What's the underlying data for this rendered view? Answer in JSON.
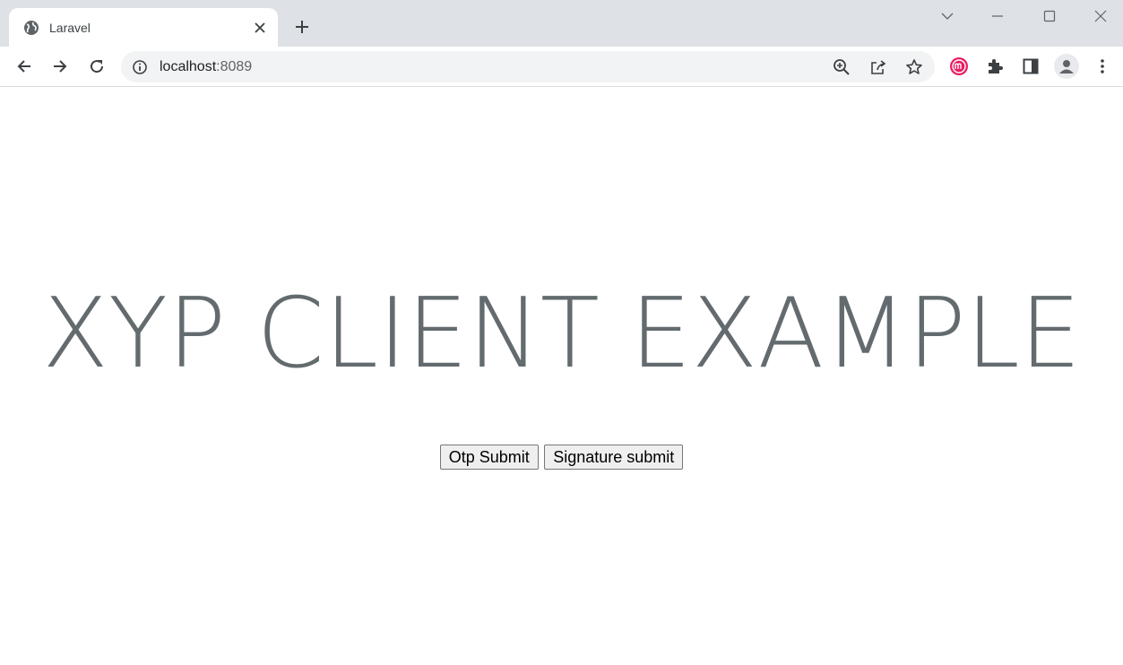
{
  "browser": {
    "tab_title": "Laravel",
    "url_host": "localhost",
    "url_port": ":8089",
    "icons": [
      "globe-icon",
      "close-icon",
      "plus-icon",
      "chevron-down-icon",
      "minimize-icon",
      "maximize-icon",
      "window-close-icon",
      "back-icon",
      "forward-icon",
      "reload-icon",
      "info-icon",
      "zoom-icon",
      "share-icon",
      "star-icon",
      "extension-m-icon",
      "puzzle-icon",
      "side-panel-icon",
      "profile-icon",
      "menu-dots-icon"
    ],
    "colors": {
      "tabstrip": "#dee1e6",
      "omnibox": "#f1f3f4",
      "extension_accent": "#e91e63"
    }
  },
  "page": {
    "headline": "XYP CLIENT EXAMPLE",
    "headline_color": "#636b6f",
    "buttons": {
      "otp_label": "Otp Submit",
      "signature_label": "Signature submit"
    }
  }
}
